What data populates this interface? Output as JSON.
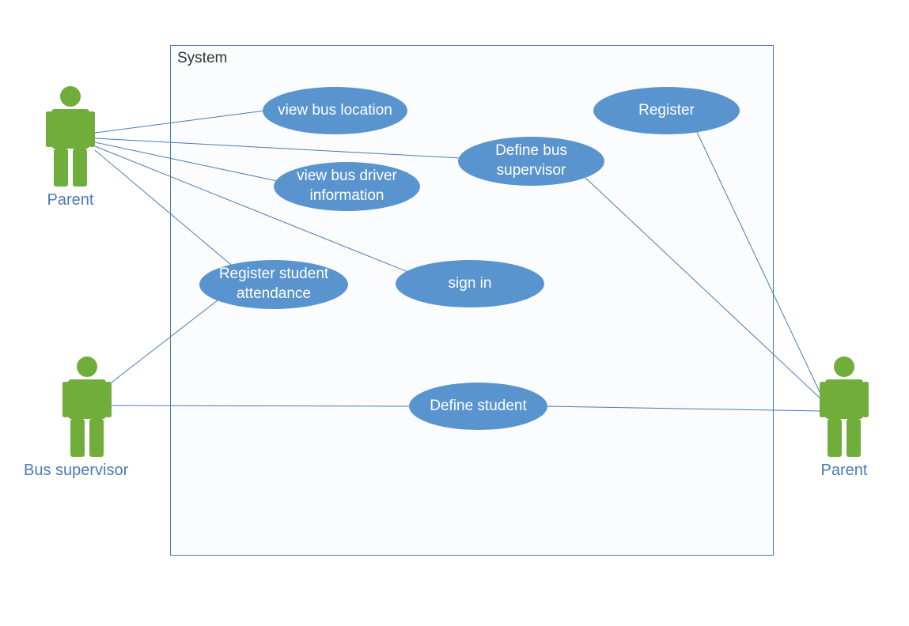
{
  "system": {
    "title": "System"
  },
  "actors": {
    "parent_left": {
      "label": "Parent"
    },
    "bus_supervisor": {
      "label": "Bus supervisor"
    },
    "parent_right": {
      "label": "Parent"
    }
  },
  "usecases": {
    "view_bus_location": {
      "label": "view bus location"
    },
    "register": {
      "label": "Register"
    },
    "view_bus_driver_info": {
      "label": "view bus driver\ninformation"
    },
    "define_bus_supervisor": {
      "label": "Define bus\nsupervisor"
    },
    "register_student_attendance": {
      "label": "Register student\nattendance"
    },
    "sign_in": {
      "label": "sign in"
    },
    "define_student": {
      "label": "Define student"
    }
  }
}
